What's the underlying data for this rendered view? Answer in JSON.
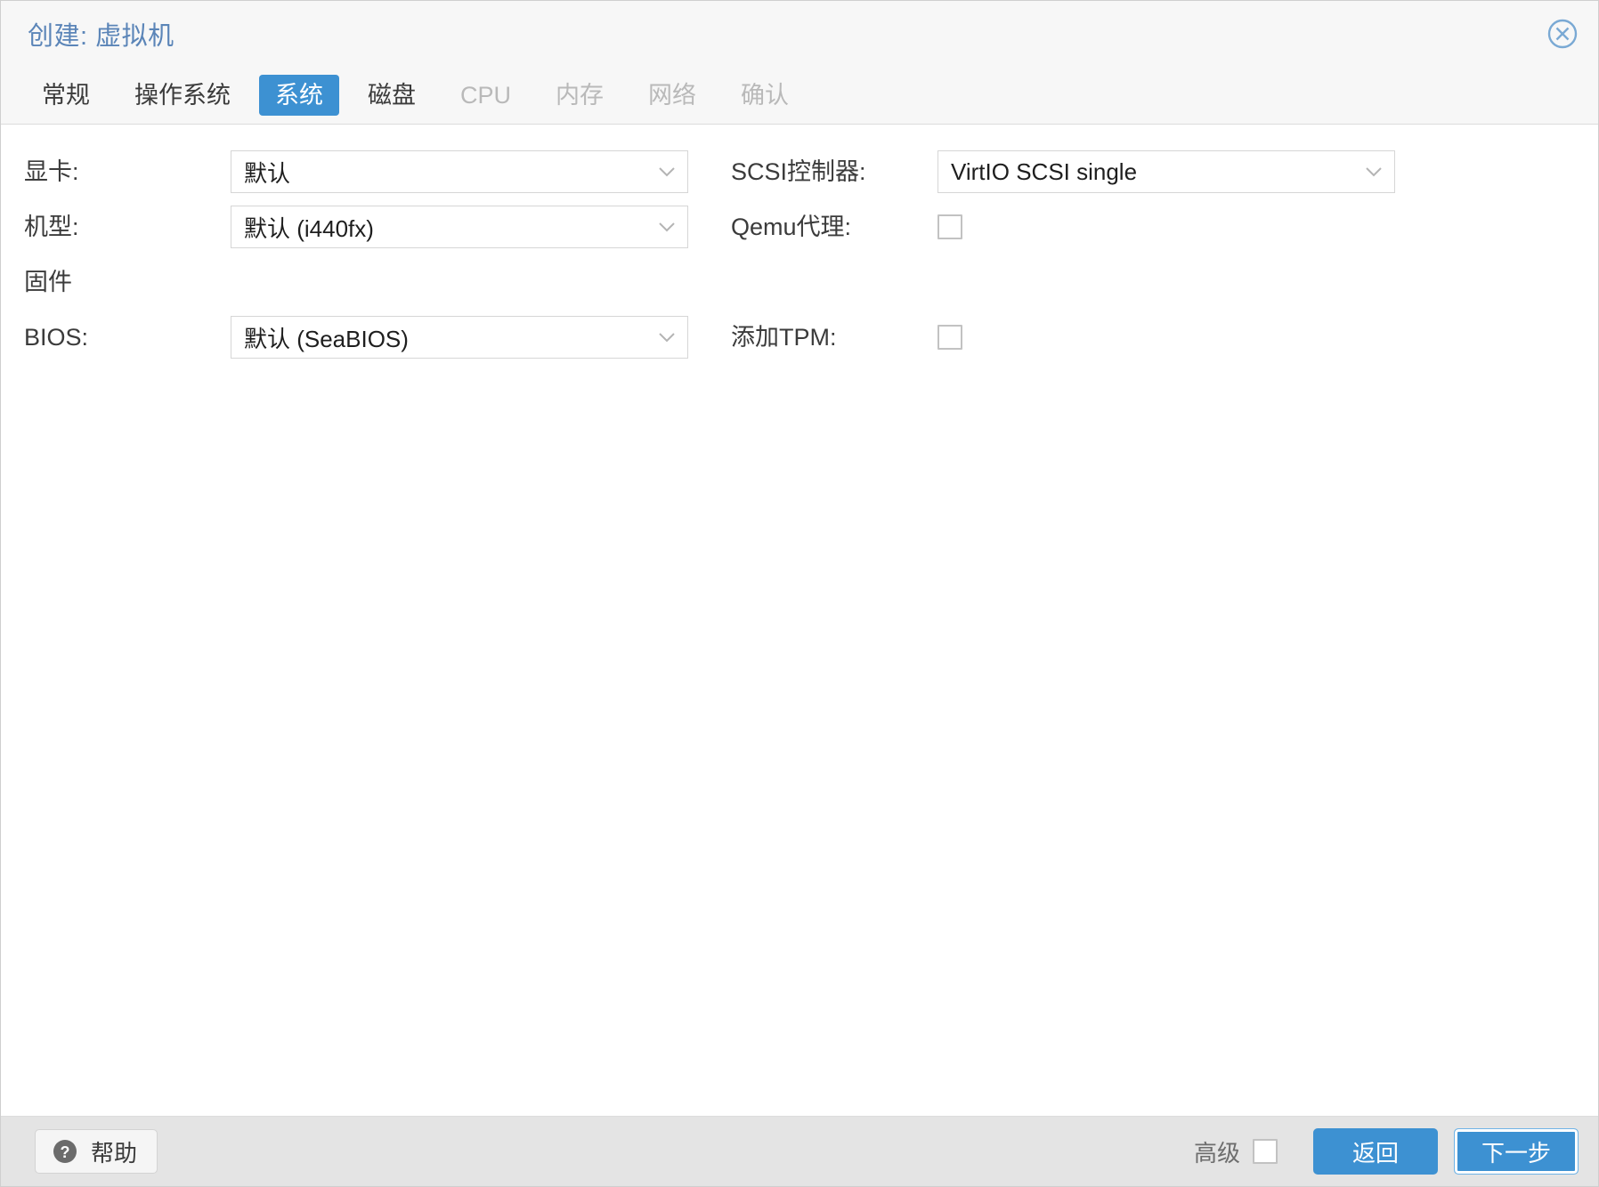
{
  "window": {
    "title": "创建: 虚拟机",
    "close_icon": "close-circle-icon"
  },
  "tabs": [
    {
      "label": "常规",
      "state": "enabled"
    },
    {
      "label": "操作系统",
      "state": "enabled"
    },
    {
      "label": "系统",
      "state": "active"
    },
    {
      "label": "磁盘",
      "state": "enabled"
    },
    {
      "label": "CPU",
      "state": "disabled"
    },
    {
      "label": "内存",
      "state": "disabled"
    },
    {
      "label": "网络",
      "state": "disabled"
    },
    {
      "label": "确认",
      "state": "disabled"
    }
  ],
  "form": {
    "left": {
      "graphic_card_label": "显卡:",
      "graphic_card_value": "默认",
      "machine_label": "机型:",
      "machine_value": "默认 (i440fx)",
      "firmware_section": "固件",
      "bios_label": "BIOS:",
      "bios_value": "默认 (SeaBIOS)"
    },
    "right": {
      "scsi_label": "SCSI控制器:",
      "scsi_value": "VirtIO SCSI single",
      "qemu_agent_label": "Qemu代理:",
      "qemu_agent_checked": false,
      "tpm_label": "添加TPM:",
      "tpm_checked": false
    }
  },
  "footer": {
    "help_label": "帮助",
    "help_icon": "question-mark-circle-icon",
    "advanced_label": "高级",
    "advanced_checked": false,
    "back_label": "返回",
    "next_label": "下一步"
  },
  "colors": {
    "accent_blue": "#3d91d2",
    "title_blue": "#5b85b8",
    "disabled_grey": "#b9b9b9",
    "footer_bg": "#e4e4e4",
    "panel_bg": "#ffffff",
    "chrome_bg": "#f7f7f7"
  }
}
